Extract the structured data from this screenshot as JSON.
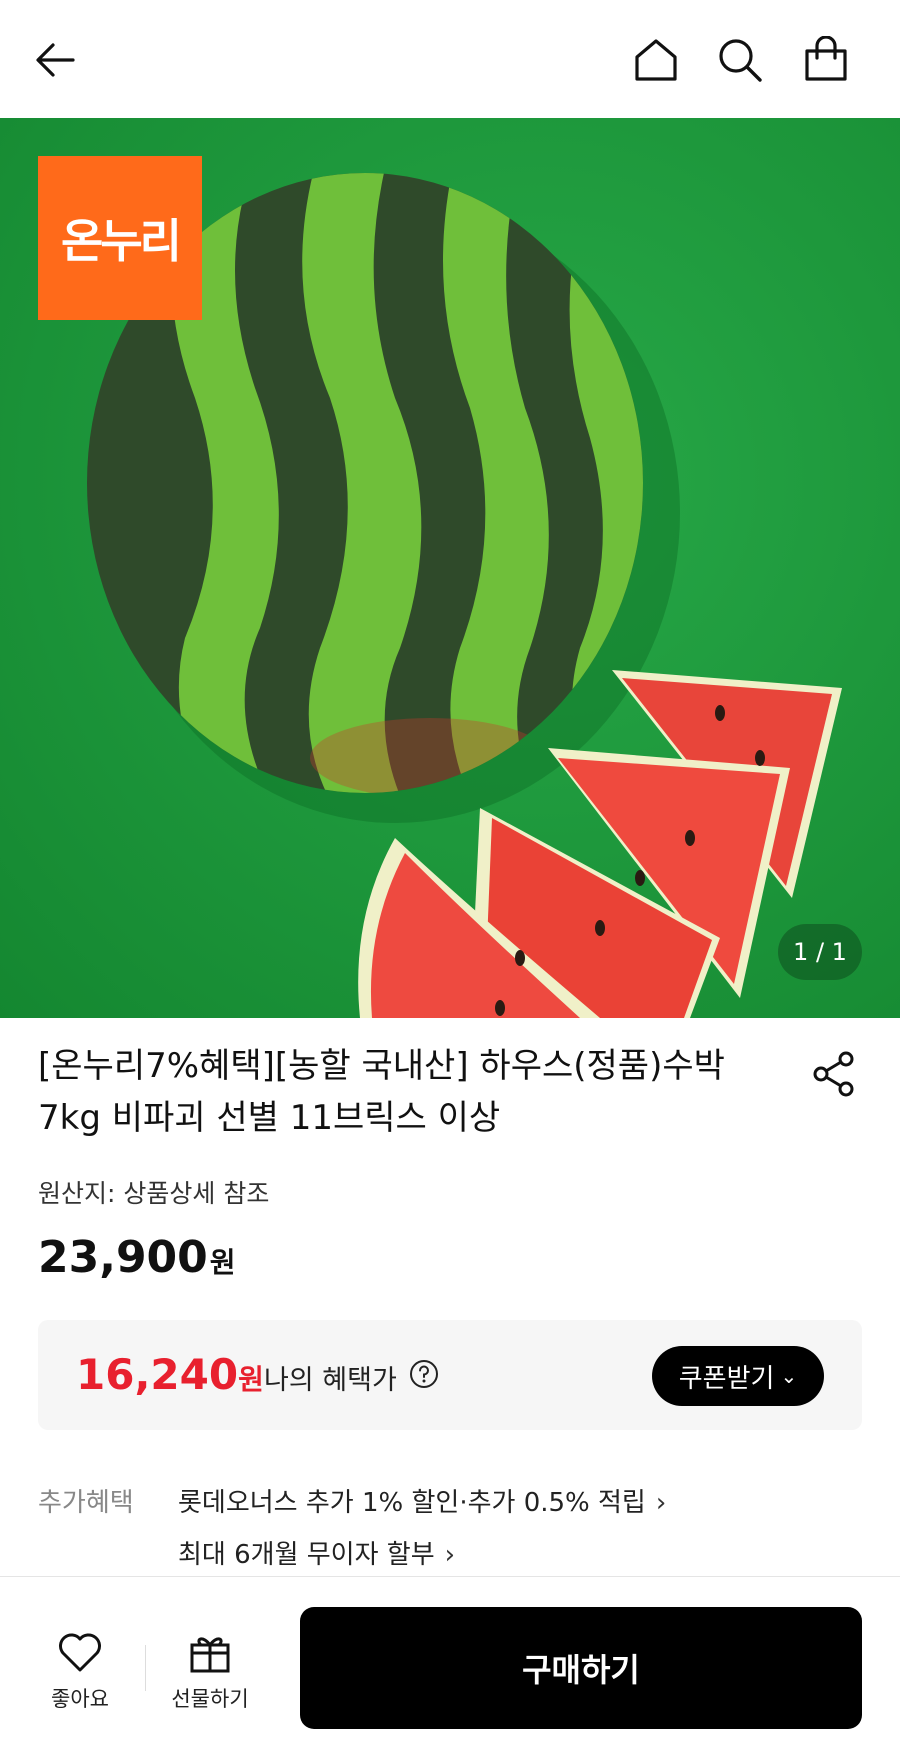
{
  "header": {
    "back_icon": "arrow-left-icon",
    "home_icon": "home-icon",
    "search_icon": "search-icon",
    "bag_icon": "shopping-bag-icon"
  },
  "hero": {
    "logo_text": "온누리",
    "counter": "1 / 1",
    "logo_color": "#ff6a1a",
    "background_color": "#1f9a3d"
  },
  "product": {
    "title": "[온누리7%혜택][농할 국내산] 하우스(정품)수박 7kg 비파괴 선별 11브릭스 이상",
    "origin": "원산지: 상품상세 참조",
    "price": "23,900",
    "price_unit": "원"
  },
  "benefit": {
    "price": "16,240",
    "price_unit": "원",
    "label": "나의 혜택가",
    "coupon_button": "쿠폰받기",
    "accent_color": "#e8202e"
  },
  "extra": {
    "label": "추가혜택",
    "items": [
      "롯데오너스 추가 1% 할인·추가 0.5% 적립",
      "최대 6개월 무이자 할부"
    ]
  },
  "bottom": {
    "like_label": "좋아요",
    "gift_label": "선물하기",
    "buy_label": "구매하기"
  }
}
